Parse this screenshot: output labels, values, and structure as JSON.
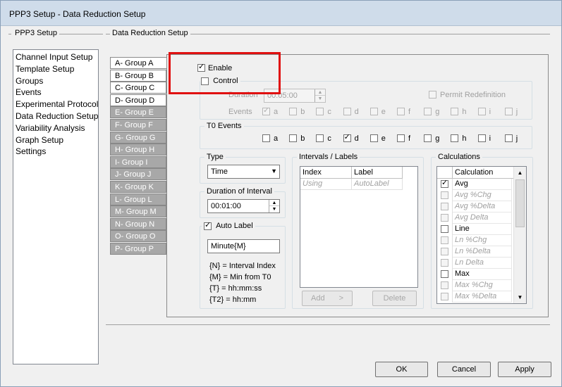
{
  "window": {
    "title": "PPP3 Setup - Data Reduction Setup"
  },
  "left_panel": {
    "title": "PPP3 Setup",
    "items": [
      "Channel Input Setup",
      "Template Setup",
      "Groups",
      "Events",
      "Experimental Protocol",
      "Data Reduction Setup",
      "Variability Analysis",
      "Graph Setup",
      "Settings"
    ],
    "selected": "Data Reduction Setup"
  },
  "main_title": "Data Reduction Setup",
  "groups": [
    "A- Group A",
    "B- Group B",
    "C- Group C",
    "D- Group D",
    "E- Group E",
    "F- Group F",
    "G- Group G",
    "H- Group H",
    "I- Group I",
    "J- Group J",
    "K- Group K",
    "L- Group L",
    "M- Group M",
    "N- Group N",
    "O- Group O",
    "P- Group P"
  ],
  "active_group": "A- Group A",
  "enable": {
    "label": "Enable",
    "checked": true
  },
  "control": {
    "label": "Control",
    "checked": false,
    "duration_label": "Duration",
    "duration_value": "00:05:00",
    "permit_label": "Permit Redefinition",
    "events_label": "Events",
    "events": [
      "a",
      "b",
      "c",
      "d",
      "e",
      "f",
      "g",
      "h",
      "i",
      "j"
    ],
    "events_checked": [
      "a"
    ]
  },
  "t0_events": {
    "title": "T0 Events",
    "events": [
      "a",
      "b",
      "c",
      "d",
      "e",
      "f",
      "g",
      "h",
      "i",
      "j"
    ],
    "checked": [
      "d"
    ]
  },
  "type": {
    "title": "Type",
    "value": "Time"
  },
  "duration_interval": {
    "title": "Duration of Interval",
    "value": "00:01:00"
  },
  "auto_label": {
    "label": "Auto Label",
    "checked": true,
    "value": "Minute{M}",
    "legend": [
      "{N} = Interval Index",
      "{M} = Min from T0",
      "{T} = hh:mm:ss",
      "{T2} = hh:mm"
    ]
  },
  "intervals": {
    "title": "Intervals / Labels",
    "columns": [
      "Index",
      "Label"
    ],
    "row": [
      "Using",
      "AutoLabel"
    ],
    "add_label": "Add",
    "add_arrow": ">",
    "delete_label": "Delete"
  },
  "calculations": {
    "title": "Calculations",
    "header": "Calculation",
    "items": [
      {
        "label": "Avg",
        "checked": true,
        "enabled": true
      },
      {
        "label": "Avg %Chg",
        "checked": false,
        "enabled": false
      },
      {
        "label": "Avg %Delta",
        "checked": false,
        "enabled": false
      },
      {
        "label": "Avg Delta",
        "checked": false,
        "enabled": false
      },
      {
        "label": "Line",
        "checked": false,
        "enabled": true
      },
      {
        "label": "Ln %Chg",
        "checked": false,
        "enabled": false
      },
      {
        "label": "Ln %Delta",
        "checked": false,
        "enabled": false
      },
      {
        "label": "Ln Delta",
        "checked": false,
        "enabled": false
      },
      {
        "label": "Max",
        "checked": false,
        "enabled": true
      },
      {
        "label": "Max %Chg",
        "checked": false,
        "enabled": false
      },
      {
        "label": "Max %Delta",
        "checked": false,
        "enabled": false
      }
    ]
  },
  "buttons": {
    "ok": "OK",
    "cancel": "Cancel",
    "apply": "Apply"
  },
  "colors": {
    "highlight_box": "#e01010",
    "disabled_tab": "#a8a8a8"
  }
}
